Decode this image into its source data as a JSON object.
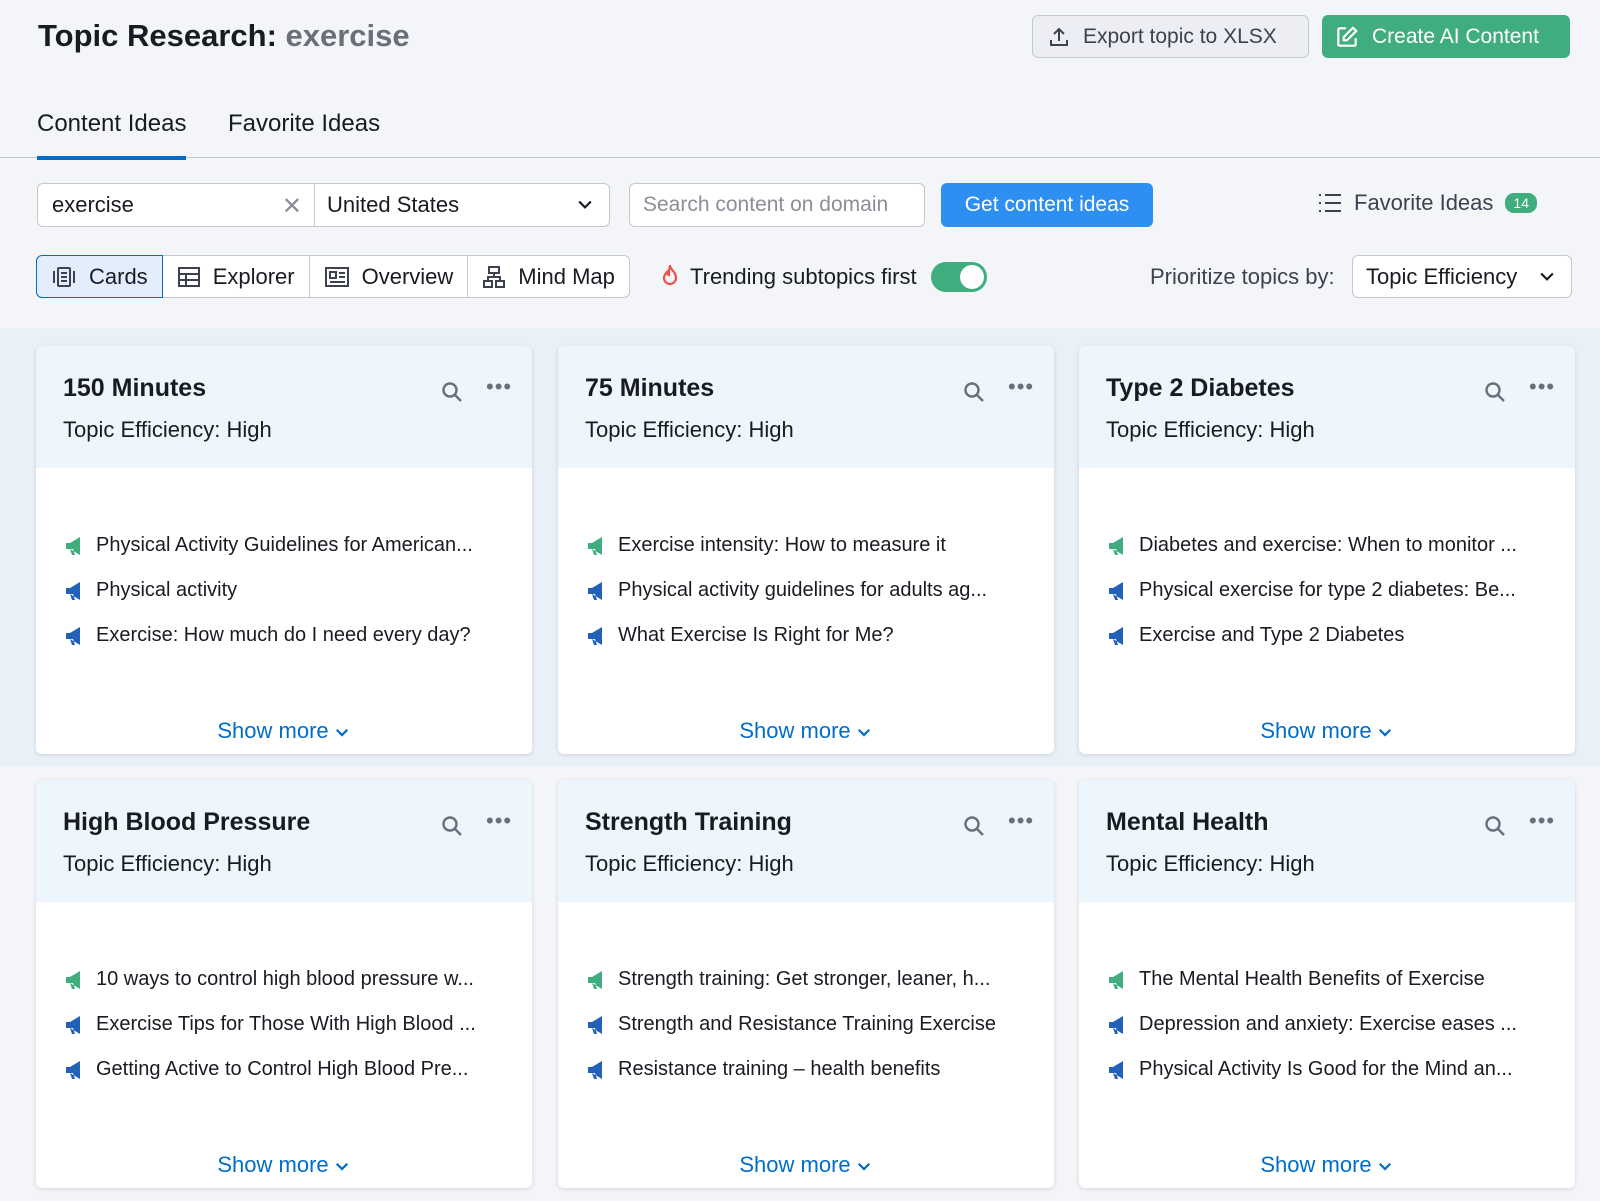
{
  "header": {
    "title_prefix": "Topic Research:",
    "title_keyword": "exercise",
    "export_label": "Export topic to XLSX",
    "create_ai_label": "Create AI Content"
  },
  "tabs": [
    {
      "label": "Content Ideas",
      "active": true
    },
    {
      "label": "Favorite Ideas",
      "active": false
    }
  ],
  "search": {
    "keyword": "exercise",
    "country": "United States",
    "domain_placeholder": "Search content on domain",
    "get_ideas_label": "Get content ideas",
    "favorites_label": "Favorite Ideas",
    "favorites_count": "14"
  },
  "views": [
    {
      "label": "Cards",
      "icon": "cards-icon",
      "active": true
    },
    {
      "label": "Explorer",
      "icon": "table-icon",
      "active": false
    },
    {
      "label": "Overview",
      "icon": "overview-icon",
      "active": false
    },
    {
      "label": "Mind Map",
      "icon": "mindmap-icon",
      "active": false
    }
  ],
  "trending": {
    "label": "Trending subtopics first",
    "enabled": true
  },
  "prioritize": {
    "label": "Prioritize topics by:",
    "value": "Topic Efficiency"
  },
  "cards": [
    {
      "title": "150 Minutes",
      "efficiency": "Topic Efficiency: High",
      "ideas": [
        {
          "text": "Physical Activity Guidelines for American...",
          "trending": true
        },
        {
          "text": "Physical activity",
          "trending": false
        },
        {
          "text": "Exercise: How much do I need every day?",
          "trending": false
        }
      ],
      "show_more": "Show more"
    },
    {
      "title": "75 Minutes",
      "efficiency": "Topic Efficiency: High",
      "ideas": [
        {
          "text": "Exercise intensity: How to measure it",
          "trending": true
        },
        {
          "text": "Physical activity guidelines for adults ag...",
          "trending": false
        },
        {
          "text": "What Exercise Is Right for Me?",
          "trending": false
        }
      ],
      "show_more": "Show more"
    },
    {
      "title": "Type 2 Diabetes",
      "efficiency": "Topic Efficiency: High",
      "ideas": [
        {
          "text": "Diabetes and exercise: When to monitor ...",
          "trending": true
        },
        {
          "text": "Physical exercise for type 2 diabetes: Be...",
          "trending": false
        },
        {
          "text": "Exercise and Type 2 Diabetes",
          "trending": false
        }
      ],
      "show_more": "Show more"
    },
    {
      "title": "High Blood Pressure",
      "efficiency": "Topic Efficiency: High",
      "ideas": [
        {
          "text": "10 ways to control high blood pressure w...",
          "trending": true
        },
        {
          "text": "Exercise Tips for Those With High Blood ...",
          "trending": false
        },
        {
          "text": "Getting Active to Control High Blood Pre...",
          "trending": false
        }
      ],
      "show_more": "Show more"
    },
    {
      "title": "Strength Training",
      "efficiency": "Topic Efficiency: High",
      "ideas": [
        {
          "text": "Strength training: Get stronger, leaner, h...",
          "trending": true
        },
        {
          "text": "Strength and Resistance Training Exercise",
          "trending": false
        },
        {
          "text": "Resistance training – health benefits",
          "trending": false
        }
      ],
      "show_more": "Show more"
    },
    {
      "title": "Mental Health",
      "efficiency": "Topic Efficiency: High",
      "ideas": [
        {
          "text": "The Mental Health Benefits of Exercise",
          "trending": true
        },
        {
          "text": "Depression and anxiety: Exercise eases ...",
          "trending": false
        },
        {
          "text": "Physical Activity Is Good for the Mind an...",
          "trending": false
        }
      ],
      "show_more": "Show more"
    }
  ],
  "colors": {
    "accent_blue": "#006dca",
    "button_blue": "#2e8ff3",
    "green": "#3fad7e",
    "trending_green": "#3fad7e",
    "normal_blue": "#2360b8",
    "card_header": "#edf5fd"
  }
}
